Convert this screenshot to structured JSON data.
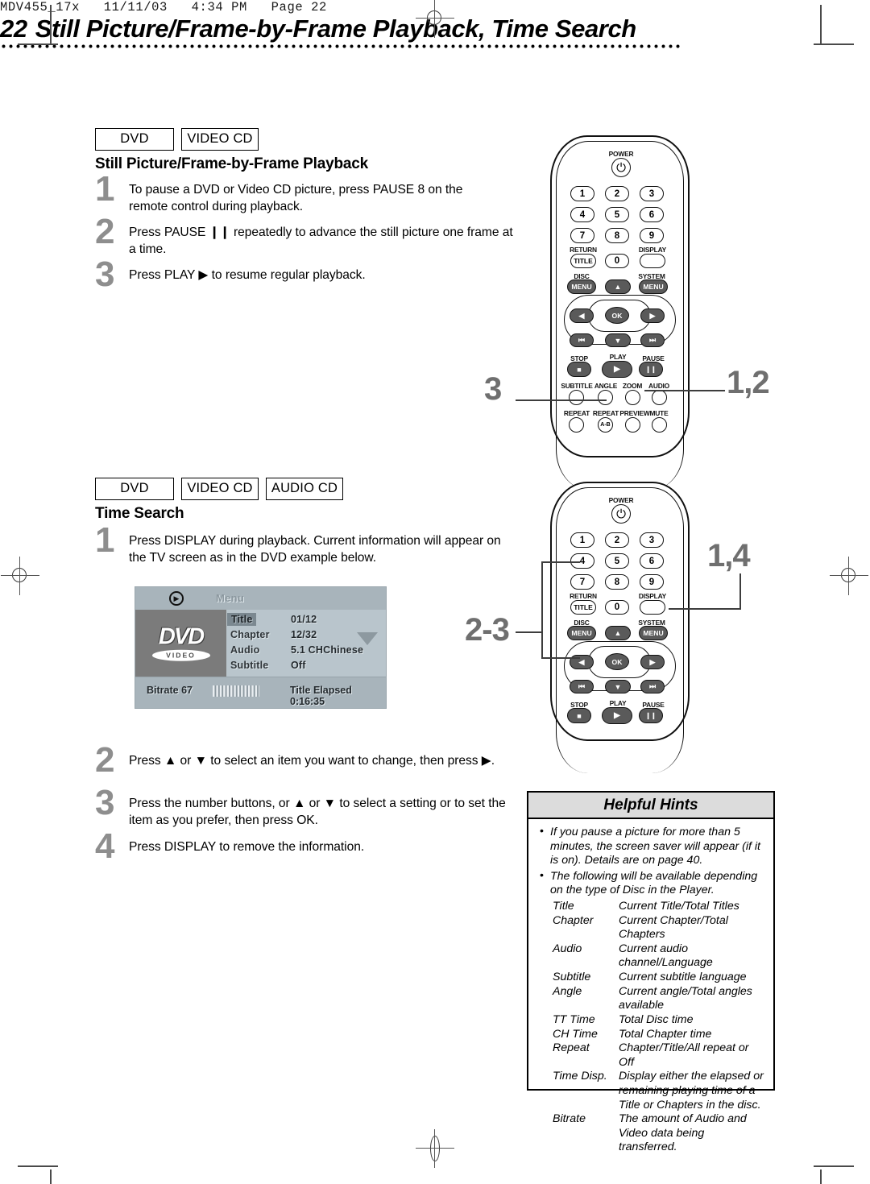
{
  "file_header": "MDV455_17x   11/11/03   4:34 PM   Page 22",
  "page": {
    "number": "22",
    "title": "Still Picture/Frame-by-Frame Playback, Time Search"
  },
  "section1": {
    "badges": [
      "DVD",
      "VIDEO CD"
    ],
    "heading": "Still Picture/Frame-by-Frame Playback",
    "steps": [
      {
        "num": "1",
        "text": "To pause a DVD or Video CD picture, press PAUSE 8 on the remote control during playback."
      },
      {
        "num": "2",
        "text": "Press PAUSE ❙❙ repeatedly to advance the still picture one frame at a time."
      },
      {
        "num": "3",
        "text": "Press PLAY ▶ to resume regular playback."
      }
    ],
    "callouts": {
      "left": "3",
      "right": "1,2"
    }
  },
  "section2": {
    "badges": [
      "DVD",
      "VIDEO CD",
      "AUDIO CD"
    ],
    "heading": "Time Search",
    "steps": [
      {
        "num": "1",
        "text": "Press DISPLAY during playback. Current information will appear on the TV screen as in the DVD example below."
      },
      {
        "num": "2",
        "text": "Press ▲ or ▼ to select an item you want to change, then press ▶."
      },
      {
        "num": "3",
        "text": "Press the number buttons, or ▲ or ▼ to select a setting or to set the item as you prefer, then press OK."
      },
      {
        "num": "4",
        "text": "Press DISPLAY to remove the information."
      }
    ],
    "callouts": {
      "left": "2-3",
      "right": "1,4"
    }
  },
  "osd": {
    "play_icon": "▶",
    "menu_label": "Menu",
    "logo_main": "DVD",
    "logo_sub": "VIDEO",
    "rows": [
      {
        "label": "Title",
        "value": "01/12",
        "selected": true
      },
      {
        "label": "Chapter",
        "value": "12/32",
        "selected": false
      },
      {
        "label": "Audio",
        "value": "5.1 CHChinese",
        "selected": false
      },
      {
        "label": "Subtitle",
        "value": "Off",
        "selected": false
      }
    ],
    "bitrate_label": "Bitrate 67",
    "elapsed_label": "Title Elapsed 0:16:35"
  },
  "remote": {
    "power_label": "POWER",
    "power_icon": "⏻",
    "numbers": [
      "1",
      "2",
      "3",
      "4",
      "5",
      "6",
      "7",
      "8",
      "9"
    ],
    "zero": "0",
    "title_key": "TITLE",
    "return_label": "RETURN",
    "display_label": "DISPLAY",
    "disc_label": "DISC",
    "system_label": "SYSTEM",
    "menu_key": "MENU",
    "ok_key": "OK",
    "up_icon": "▲",
    "down_icon": "▼",
    "left_icon": "◀",
    "right_icon": "▶",
    "prev_icon": "⏮",
    "next_icon": "⏭",
    "stop_label": "STOP",
    "play_label": "PLAY",
    "pause_label": "PAUSE",
    "stop_icon": "■",
    "play_icon": "▶",
    "pause_icon": "❙❙",
    "row_a": [
      "SUBTITLE",
      "ANGLE",
      "ZOOM",
      "AUDIO"
    ],
    "row_b": [
      "REPEAT",
      "REPEAT",
      "PREVIEW",
      "MUTE"
    ],
    "ab_key": "A-B"
  },
  "hints": {
    "title": "Helpful Hints",
    "bullets": [
      "If you pause a picture for more than 5 minutes, the screen saver will appear (if it is on). Details are on page 40.",
      "The following will be available depending on the type of Disc in the Player."
    ],
    "table": [
      {
        "key": "Title",
        "value": "Current Title/Total Titles"
      },
      {
        "key": "Chapter",
        "value": "Current Chapter/Total Chapters"
      },
      {
        "key": "Audio",
        "value": "Current audio channel/Language"
      },
      {
        "key": "Subtitle",
        "value": "Current subtitle language"
      },
      {
        "key": "Angle",
        "value": "Current angle/Total angles available"
      },
      {
        "key": "TT Time",
        "value": "Total Disc time"
      },
      {
        "key": "CH Time",
        "value": "Total Chapter time"
      },
      {
        "key": "Repeat",
        "value": "Chapter/Title/All repeat or Off"
      },
      {
        "key": "Time Disp.",
        "value": "Display either the elapsed or remaining playing time of a Title or Chapters in the disc."
      },
      {
        "key": "Bitrate",
        "value": "The amount of Audio and Video data being transferred."
      }
    ]
  }
}
